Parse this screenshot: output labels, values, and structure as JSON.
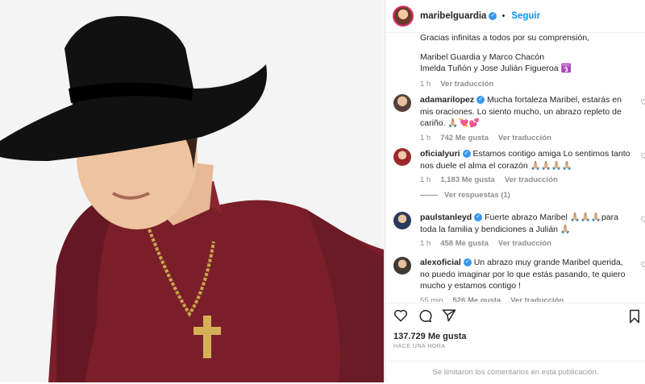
{
  "post": {
    "username": "maribelguardia",
    "follow_label": "Seguir"
  },
  "caption": {
    "line1": "Gracias infinitas a todos por su comprensión,",
    "line2": "Maribel Guardia y Marco Chacón",
    "line3": "Imelda Tuñón y Jose Julián Figueroa",
    "emoji": "🛐",
    "time": "1 h",
    "translate": "Ver traducción"
  },
  "comments": [
    {
      "user": "adamarilopez",
      "text": "Mucha fortaleza Maribel, estarás en mis oraciones. Lo siento mucho, un abrazo repleto de cariño. 🙏🏼💘💕",
      "time": "1 h",
      "likes": "742 Me gusta",
      "translate": "Ver traducción"
    },
    {
      "user": "oficialyuri",
      "text": "Estamos contigo amiga Lo sentimos tanto nos duele el alma el corazón 🙏🏼🙏🏼🙏🏼🙏🏼",
      "time": "1 h",
      "likes": "1,183 Me gusta",
      "translate": "Ver traducción",
      "replies": "Ver respuestas (1)"
    },
    {
      "user": "paulstanleyd",
      "text": "Fuerte abrazo Maribel 🙏🏼🙏🏼🙏🏼para toda la familia y bendiciones a Julián 🙏🏼",
      "time": "1 h",
      "likes": "458 Me gusta",
      "translate": "Ver traducción"
    },
    {
      "user": "alexoficial",
      "text": "Un abrazo muy grande Maribel querida, no puedo imaginar por lo que estás pasando, te quiero mucho y estamos contigo !",
      "time": "55 min",
      "likes": "526 Me gusta",
      "translate": "Ver traducción"
    }
  ],
  "footer": {
    "likes": "137.729 Me gusta",
    "timeago": "HACE UNA HORA",
    "disabled_note": "Se limitaron los comentarios en esta publicación."
  },
  "icons": [
    "heart-icon",
    "comment-icon",
    "share-icon",
    "bookmark-icon",
    "verified-icon"
  ],
  "colors": {
    "accent": "#0095f6",
    "verified": "#3897f0",
    "muted": "#8e8e8e",
    "shirt": "#7a1f2a"
  }
}
